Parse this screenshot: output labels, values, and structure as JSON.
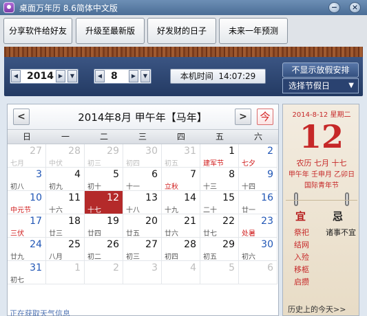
{
  "window": {
    "title": "桌面万年历 8.6简体中文版",
    "minimize": "−",
    "close": "×"
  },
  "toolbar": {
    "buttons": [
      "分享软件给好友",
      "升级至最新版",
      "好发财的日子",
      "未来一年预测"
    ]
  },
  "controls": {
    "year": "2014",
    "month": "8",
    "clock_label": "本机时间",
    "clock_time": "14:07:29",
    "hide_holiday_label": "不显示放假安排",
    "holiday_select": "选择节假日"
  },
  "calendar": {
    "title": "2014年8月  甲午年【马年】",
    "prev": "<",
    "next": ">",
    "today": "今",
    "weekdays": [
      "日",
      "一",
      "二",
      "三",
      "四",
      "五",
      "六"
    ],
    "days": [
      {
        "n": "27",
        "l": "七月",
        "out": true
      },
      {
        "n": "28",
        "l": "中伏",
        "out": true
      },
      {
        "n": "29",
        "l": "初三",
        "out": true
      },
      {
        "n": "30",
        "l": "初四",
        "out": true
      },
      {
        "n": "31",
        "l": "初五",
        "out": true
      },
      {
        "n": "1",
        "l": "建军节",
        "fest": true
      },
      {
        "n": "2",
        "l": "七夕",
        "fest": true
      },
      {
        "n": "3",
        "l": "初八"
      },
      {
        "n": "4",
        "l": "初九"
      },
      {
        "n": "5",
        "l": "初十"
      },
      {
        "n": "6",
        "l": "十一"
      },
      {
        "n": "7",
        "l": "立秋",
        "fest": true
      },
      {
        "n": "8",
        "l": "十三"
      },
      {
        "n": "9",
        "l": "十四"
      },
      {
        "n": "10",
        "l": "中元节",
        "fest": true
      },
      {
        "n": "11",
        "l": "十六"
      },
      {
        "n": "12",
        "l": "十七",
        "sel": true
      },
      {
        "n": "13",
        "l": "十八"
      },
      {
        "n": "14",
        "l": "十九"
      },
      {
        "n": "15",
        "l": "二十"
      },
      {
        "n": "16",
        "l": "廿一"
      },
      {
        "n": "17",
        "l": "三伏",
        "fest": true
      },
      {
        "n": "18",
        "l": "廿三"
      },
      {
        "n": "19",
        "l": "廿四"
      },
      {
        "n": "20",
        "l": "廿五"
      },
      {
        "n": "21",
        "l": "廿六"
      },
      {
        "n": "22",
        "l": "廿七"
      },
      {
        "n": "23",
        "l": "处暑",
        "fest": true
      },
      {
        "n": "24",
        "l": "廿九"
      },
      {
        "n": "25",
        "l": "八月"
      },
      {
        "n": "26",
        "l": "初二"
      },
      {
        "n": "27",
        "l": "初三"
      },
      {
        "n": "28",
        "l": "初四"
      },
      {
        "n": "29",
        "l": "初五"
      },
      {
        "n": "30",
        "l": "初六"
      },
      {
        "n": "31",
        "l": "初七"
      },
      {
        "n": "1",
        "l": "",
        "out": true
      },
      {
        "n": "2",
        "l": "",
        "out": true
      },
      {
        "n": "3",
        "l": "",
        "out": true
      },
      {
        "n": "4",
        "l": "",
        "out": true
      },
      {
        "n": "5",
        "l": "",
        "out": true
      },
      {
        "n": "6",
        "l": "",
        "out": true
      }
    ],
    "weather_link": "正在获取天气信息"
  },
  "almanac": {
    "date": "2014-8-12 星期二",
    "day": "12",
    "lunar": "农历 七月 十七",
    "ganzhi": "甲午年 壬申月 乙卯日",
    "festival": "国际青年节",
    "yi_label": "宜",
    "ji_label": "忌",
    "yi_items": [
      "祭祀",
      "结网",
      "入殓",
      "移柩",
      "启攒"
    ],
    "ji_items": [
      "诸事不宜"
    ],
    "history_link": "历史上的今天>>"
  }
}
